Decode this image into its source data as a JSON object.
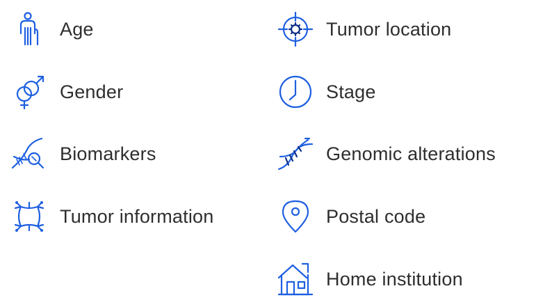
{
  "items": [
    {
      "label": "Age",
      "icon": "elderly-person-with-cane-icon"
    },
    {
      "label": "Gender",
      "icon": "gender-symbols-icon"
    },
    {
      "label": "Biomarkers",
      "icon": "dna-magnifier-icon"
    },
    {
      "label": "Tumor information",
      "icon": "tumor-cell-icon"
    },
    {
      "label": "Tumor location",
      "icon": "target-crosshair-icon"
    },
    {
      "label": "Stage",
      "icon": "clock-icon"
    },
    {
      "label": "Genomic alterations",
      "icon": "dna-helix-icon"
    },
    {
      "label": "Postal code",
      "icon": "location-pin-icon"
    },
    {
      "label": "Home institution",
      "icon": "house-icon"
    }
  ],
  "colors": {
    "icon_blue": "#1e5fe0",
    "icon_dark": "#0c2f86",
    "text": "#2e2e2e"
  }
}
